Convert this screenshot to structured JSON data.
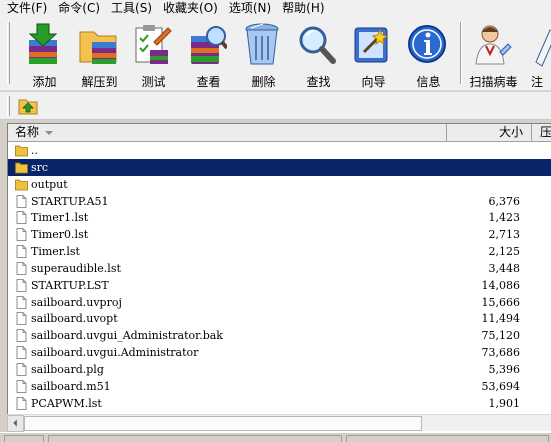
{
  "menu": [
    "文件(F)",
    "命令(C)",
    "工具(S)",
    "收藏夹(O)",
    "选项(N)",
    "帮助(H)"
  ],
  "toolbar": {
    "add": "添加",
    "extract": "解压到",
    "test": "测试",
    "view": "查看",
    "delete": "删除",
    "find": "查找",
    "wizard": "向导",
    "info": "信息",
    "virus": "扫描病毒",
    "comment": "注"
  },
  "columns": {
    "name": "名称",
    "size": "大小",
    "packed": "压"
  },
  "files": [
    {
      "name": "..",
      "size": "",
      "type": "folder"
    },
    {
      "name": "src",
      "size": "",
      "type": "folder",
      "selected": true
    },
    {
      "name": "output",
      "size": "",
      "type": "folder"
    },
    {
      "name": "STARTUP.A51",
      "size": "6,376",
      "type": "file"
    },
    {
      "name": "Timer1.lst",
      "size": "1,423",
      "type": "file"
    },
    {
      "name": "Timer0.lst",
      "size": "2,713",
      "type": "file"
    },
    {
      "name": "Timer.lst",
      "size": "2,125",
      "type": "file"
    },
    {
      "name": "superaudible.lst",
      "size": "3,448",
      "type": "file"
    },
    {
      "name": "STARTUP.LST",
      "size": "14,086",
      "type": "file"
    },
    {
      "name": "sailboard.uvproj",
      "size": "15,666",
      "type": "file"
    },
    {
      "name": "sailboard.uvopt",
      "size": "11,494",
      "type": "file"
    },
    {
      "name": "sailboard.uvgui_Administrator.bak",
      "size": "75,120",
      "type": "file"
    },
    {
      "name": "sailboard.uvgui.Administrator",
      "size": "73,686",
      "type": "file"
    },
    {
      "name": "sailboard.plg",
      "size": "5,396",
      "type": "file"
    },
    {
      "name": "sailboard.m51",
      "size": "53,694",
      "type": "file"
    },
    {
      "name": "PCAPWM.lst",
      "size": "1,901",
      "type": "file"
    }
  ],
  "colors": {
    "selection": "#0a246a",
    "folder": "#f0c040"
  }
}
